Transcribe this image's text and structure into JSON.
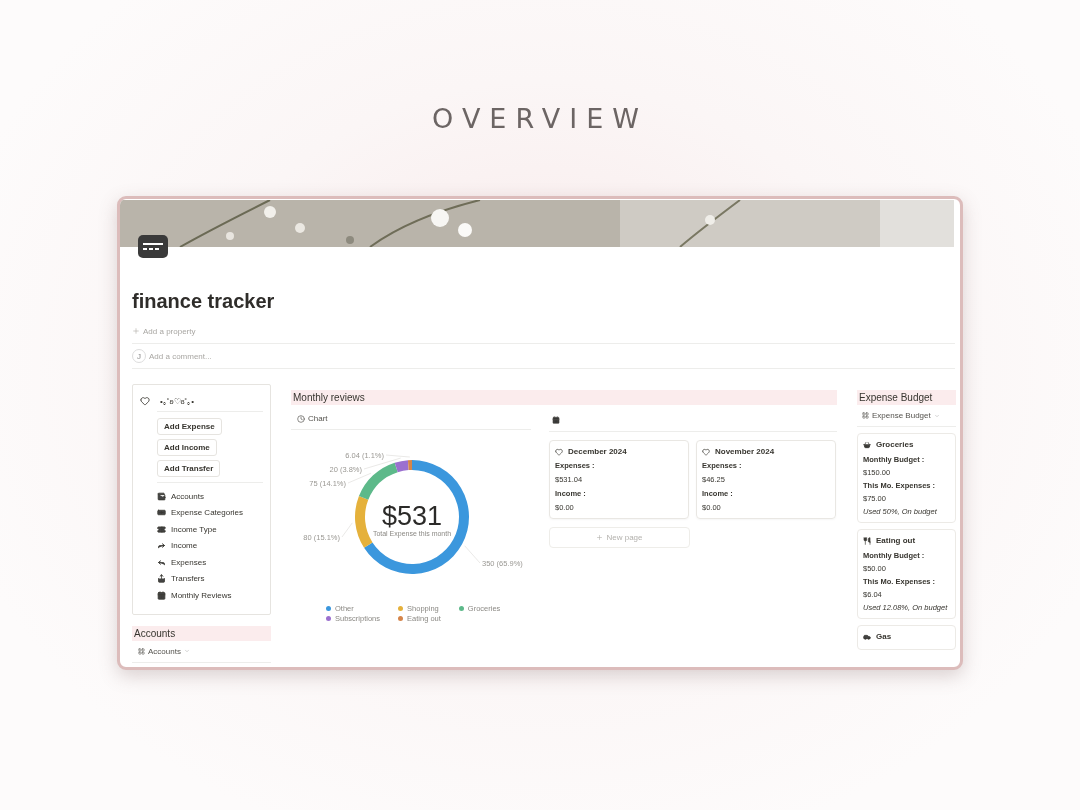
{
  "heading": "OVERVIEW",
  "page": {
    "title": "finance tracker",
    "add_property": "Add a property",
    "comment_avatar": "J",
    "add_comment": "Add a comment..."
  },
  "sidebar": {
    "title": "•｡˚ʚ♡ɞ˚｡•",
    "buttons": [
      "Add Expense",
      "Add Income",
      "Add Transfer"
    ],
    "links": [
      "Accounts",
      "Expense Categories",
      "Income Type",
      "Income",
      "Expenses",
      "Transfers",
      "Monthly Reviews"
    ]
  },
  "accounts": {
    "title": "Accounts",
    "view": "Accounts"
  },
  "monthly_reviews": {
    "title": "Monthly reviews",
    "chart_view": "Chart",
    "center_value": "$531",
    "center_caption": "Total Expense this month",
    "chart_data": {
      "type": "donut",
      "legend": "bottom",
      "categories": [
        "Other",
        "Shopping",
        "Groceries",
        "Subscriptions",
        "Eating out"
      ],
      "values": [
        350,
        80,
        75,
        20,
        6.04
      ],
      "colors": [
        "#3b97dd",
        "#e5b13b",
        "#5db98a",
        "#9b70cf",
        "#d5854a"
      ],
      "value_labels": [
        "350 (65.9%)",
        "80 (15.1%)",
        "75 (14.1%)",
        "20 (3.8%)",
        "6.04 (1.1%)"
      ]
    },
    "gallery_cards": [
      {
        "title": "December 2024",
        "fields": [
          {
            "label": "Expenses :",
            "value": "$531.04"
          },
          {
            "label": "Income :",
            "value": "$0.00"
          }
        ]
      },
      {
        "title": "November 2024",
        "fields": [
          {
            "label": "Expenses :",
            "value": "$46.25"
          },
          {
            "label": "Income :",
            "value": "$0.00"
          }
        ]
      }
    ],
    "new_page": "New page"
  },
  "expense_budget": {
    "title": "Expense Budget",
    "view": "Expense Budget",
    "cards": [
      {
        "title": "Groceries",
        "fields": [
          {
            "label": "Monthly Budget :",
            "value": "$150.00"
          },
          {
            "label": "This Mo. Expenses :",
            "value": "$75.00"
          }
        ],
        "note": "Used 50%, On budget"
      },
      {
        "title": "Eating out",
        "fields": [
          {
            "label": "Monthly Budget :",
            "value": "$50.00"
          },
          {
            "label": "This Mo. Expenses :",
            "value": "$6.04"
          }
        ],
        "note": "Used 12.08%, On budget"
      },
      {
        "title": "Gas"
      }
    ]
  }
}
